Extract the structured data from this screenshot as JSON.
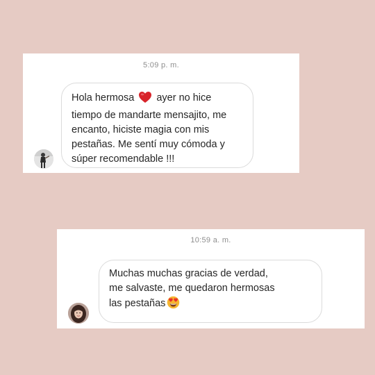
{
  "messages": [
    {
      "timestamp": "5:09 p. m.",
      "lines": [
        {
          "before": "Hola hermosa",
          "emoji": "red-heart-icon",
          "after": "ayer no hice"
        },
        {
          "text": "tiempo de mandarte mensajito, me"
        },
        {
          "text": "encanto, hiciste magia con mis"
        },
        {
          "text": "pestañas. Me sentí muy cómoda y"
        },
        {
          "text": "súper recomendable !!!"
        }
      ]
    },
    {
      "timestamp": "10:59 a. m.",
      "lines": [
        {
          "text": "Muchas muchas gracias de verdad,"
        },
        {
          "text": "me salvaste, me quedaron hermosas"
        },
        {
          "before": "las pestañas",
          "emoji": "heart-eyes-icon"
        }
      ]
    }
  ],
  "colors": {
    "background": "#e6cbc4",
    "card": "#ffffff",
    "bubble_border": "#dbdbdb",
    "text": "#262626",
    "timestamp": "#8e8e8e"
  }
}
